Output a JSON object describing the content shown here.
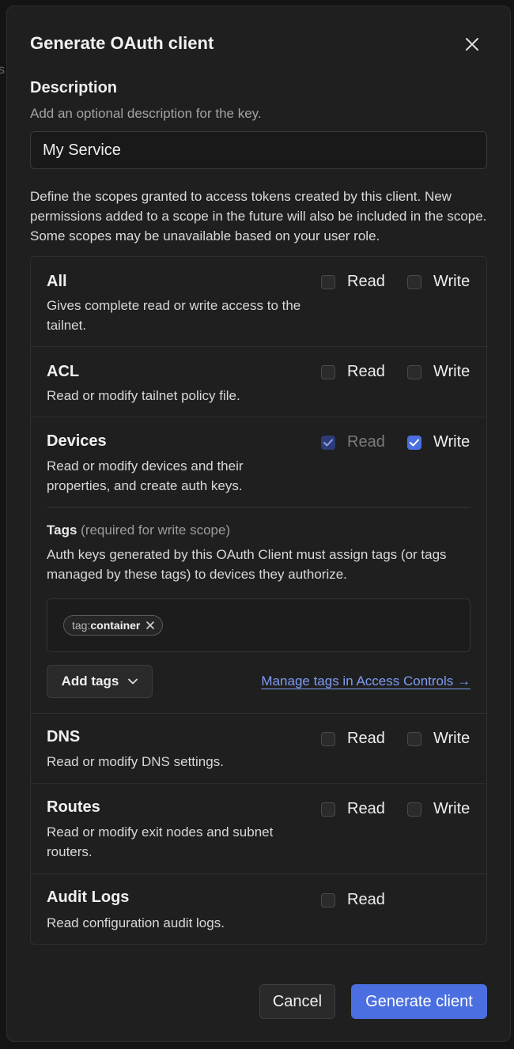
{
  "background": {
    "left_fragment": "s"
  },
  "dialog": {
    "title": "Generate OAuth client",
    "close_icon": "close-icon"
  },
  "description": {
    "label": "Description",
    "hint": "Add an optional description for the key.",
    "value": "My Service"
  },
  "scopes_intro": "Define the scopes granted to access tokens created by this client. New permissions added to a scope in the future will also be included in the scope. Some scopes may be unavailable based on your user role.",
  "read_label": "Read",
  "write_label": "Write",
  "scopes": {
    "all": {
      "name": "All",
      "description": "Gives complete read or write access to the tailnet.",
      "read": false,
      "write": false
    },
    "acl": {
      "name": "ACL",
      "description": "Read or modify tailnet policy file.",
      "read": false,
      "write": false
    },
    "devices": {
      "name": "Devices",
      "description": "Read or modify devices and their properties, and create auth keys.",
      "read": true,
      "read_disabled": true,
      "write": true,
      "tags": {
        "title": "Tags",
        "required_note": "(required for write scope)",
        "description": "Auth keys generated by this OAuth Client must assign tags (or tags managed by these tags) to devices they authorize.",
        "chips": [
          {
            "prefix": "tag:",
            "value": "container"
          }
        ],
        "add_button": "Add tags",
        "manage_link": "Manage tags in Access Controls →"
      }
    },
    "dns": {
      "name": "DNS",
      "description": "Read or modify DNS settings.",
      "read": false,
      "write": false
    },
    "routes": {
      "name": "Routes",
      "description": "Read or modify exit nodes and subnet routers.",
      "read": false,
      "write": false
    },
    "audit_logs": {
      "name": "Audit Logs",
      "description": "Read configuration audit logs.",
      "read": false
    }
  },
  "footer": {
    "cancel": "Cancel",
    "generate": "Generate client"
  },
  "colors": {
    "accent": "#4b6fe0",
    "link": "#7f9cf5",
    "surface": "#1f1f1f"
  }
}
